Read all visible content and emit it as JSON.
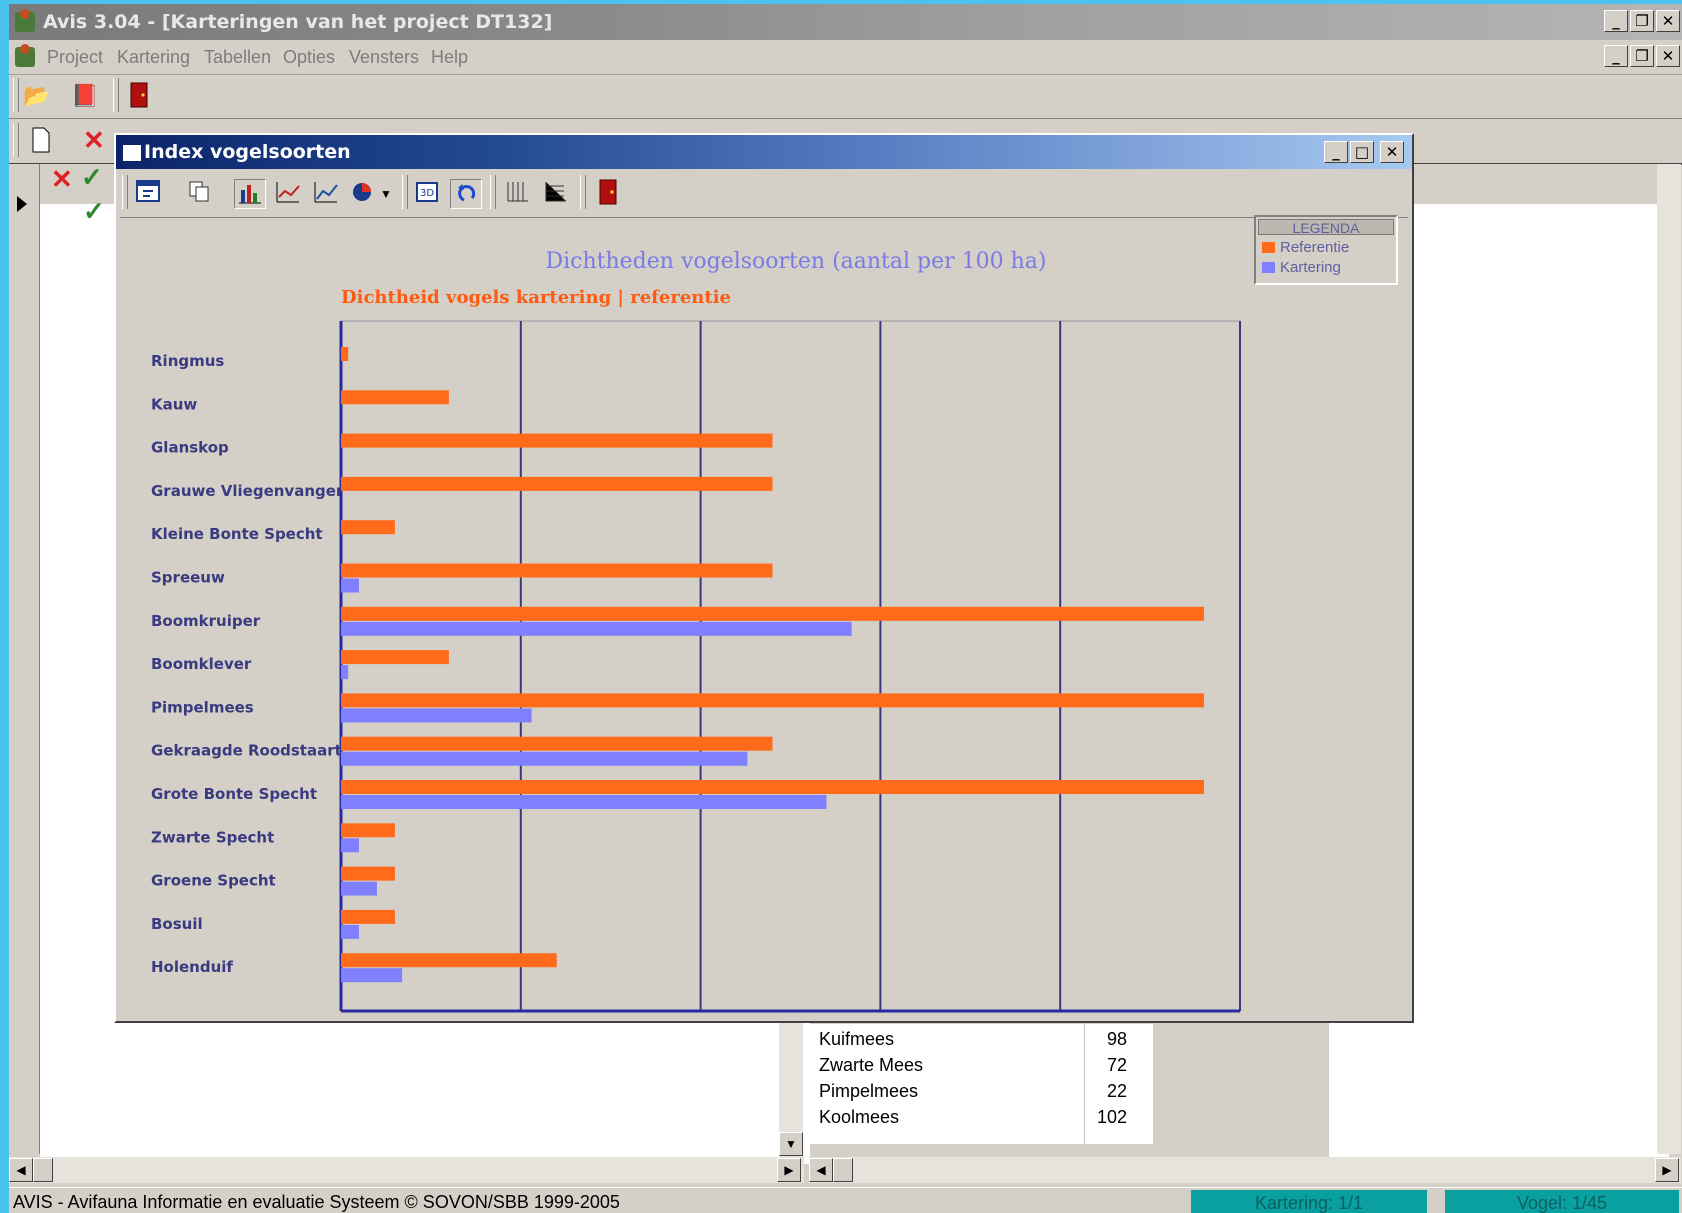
{
  "app": {
    "title": "Avis 3.04 - [Karteringen van het project DT132]",
    "menu": [
      "Project",
      "Kartering",
      "Tabellen",
      "Opties",
      "Vensters",
      "Help"
    ]
  },
  "child": {
    "title": "Index vogelsoorten",
    "legend": {
      "title": "LEGENDA",
      "items": [
        "Referentie",
        "Kartering"
      ]
    }
  },
  "chart_data": {
    "type": "bar",
    "orientation": "horizontal",
    "title": "Dichtheden vogelsoorten (aantal per 100 ha)",
    "subtitle": "Dichtheid vogels kartering | referentie",
    "categories": [
      "Ringmus",
      "Kauw",
      "Glanskop",
      "Grauwe Vliegenvanger",
      "Kleine Bonte Specht",
      "Spreeuw",
      "Boomkruiper",
      "Boomklever",
      "Pimpelmees",
      "Gekraagde Roodstaart",
      "Grote Bonte Specht",
      "Zwarte Specht",
      "Groene Specht",
      "Bosuil",
      "Holenduif"
    ],
    "series": [
      {
        "name": "Referentie",
        "color": "#ff6b1a",
        "values": [
          0.2,
          3,
          12,
          12,
          1.5,
          12,
          24,
          3,
          24,
          12,
          24,
          1.5,
          1.5,
          1.5,
          6
        ]
      },
      {
        "name": "Kartering",
        "color": "#8080ff",
        "values": [
          0,
          0,
          0,
          0,
          0,
          0.5,
          14.2,
          0.2,
          5.3,
          11.3,
          13.5,
          0.5,
          1,
          0.5,
          1.7
        ]
      }
    ],
    "xlim": [
      0,
      25
    ],
    "xticks": [
      0,
      5,
      10,
      15,
      20,
      25
    ],
    "grid": "vertical",
    "legend_position": "top-right"
  },
  "species_list": [
    {
      "name": "Kuifmees",
      "count": "98"
    },
    {
      "name": "Zwarte Mees",
      "count": "72"
    },
    {
      "name": "Pimpelmees",
      "count": "22"
    },
    {
      "name": "Koolmees",
      "count": "102"
    }
  ],
  "statusbar": {
    "text": "AVIS - Avifauna Informatie en evaluatie Systeem  © SOVON/SBB 1999-2005",
    "panel1": "Kartering: 1/1",
    "panel2": "Vogel: 1/45"
  }
}
